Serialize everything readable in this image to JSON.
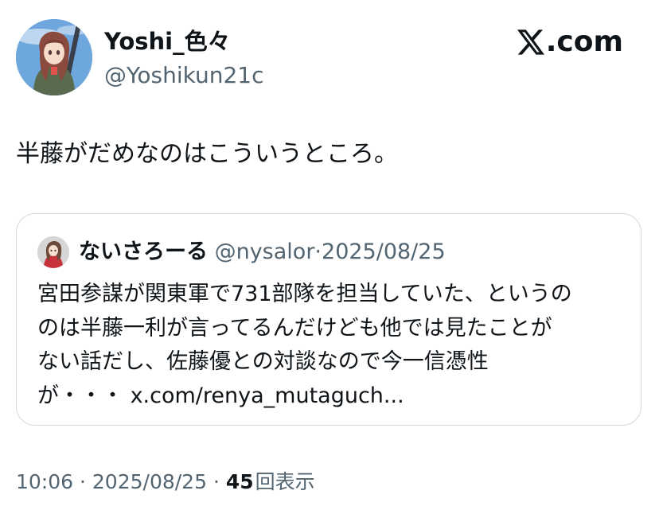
{
  "author": {
    "name": "Yoshi_色々",
    "handle": "@Yoshikun21c",
    "avatar_icon": "anime-character-avatar-icon"
  },
  "brand": {
    "logo_icon": "x-logo-icon",
    "label": ".com"
  },
  "tweet": {
    "text": "半藤がだめなのはこういうところ。"
  },
  "quote": {
    "avatar_icon": "anime-character-avatar-icon",
    "name": "ないさろーる",
    "handle": "@nysalor",
    "separator": "·",
    "date": "2025/08/25",
    "lines": [
      "宮田参謀が関東軍で731部隊を担当していた、というの",
      "のは半藤一利が言ってるんだけども他では見たことが",
      "ない話だし、佐藤優との対談なので今一信憑性",
      "が・・・ x.com/renya_mutaguch..."
    ]
  },
  "footer": {
    "time": "10:06",
    "separator1": "·",
    "date": "2025/08/25",
    "separator2": "·",
    "views_count": "45",
    "views_label": "回表示"
  },
  "colors": {
    "text_primary": "#0f1419",
    "text_secondary": "#536471",
    "border": "#cfd9de",
    "background": "#ffffff"
  }
}
